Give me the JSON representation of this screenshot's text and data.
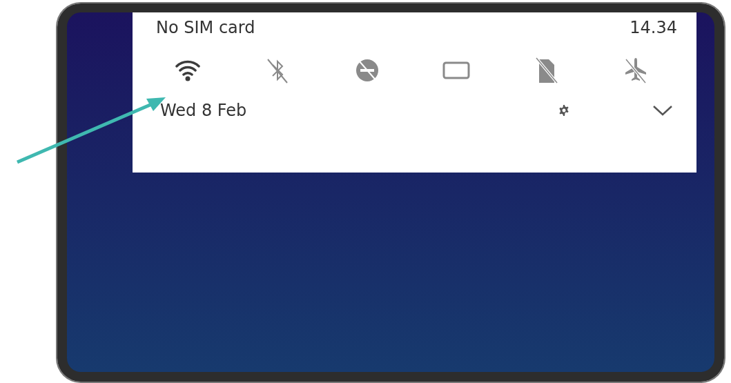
{
  "status": {
    "carrier": "No SIM card",
    "time": "14.34"
  },
  "tiles": [
    {
      "kind": "wifi",
      "on": true
    },
    {
      "kind": "bluetooth",
      "on": false
    },
    {
      "kind": "dnd",
      "on": false
    },
    {
      "kind": "rotation",
      "on": false
    },
    {
      "kind": "sim",
      "on": false
    },
    {
      "kind": "airplane",
      "on": false
    }
  ],
  "date": "Wed 8 Feb"
}
